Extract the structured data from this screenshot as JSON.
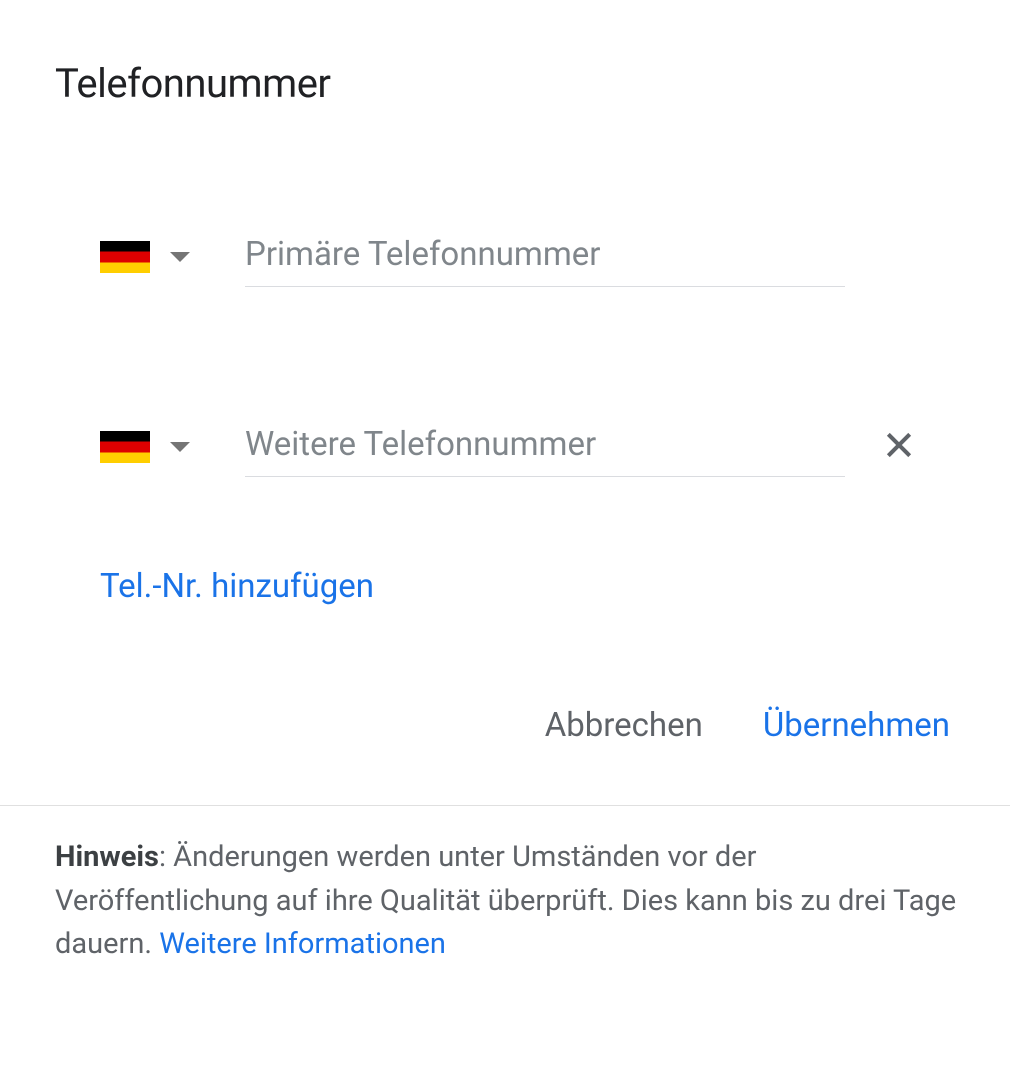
{
  "title": "Telefonnummer",
  "phones": {
    "primary": {
      "placeholder": "Primäre Telefonnummer",
      "value": ""
    },
    "secondary": {
      "placeholder": "Weitere Telefonnummer",
      "value": ""
    }
  },
  "add_link": "Tel.-Nr. hinzufügen",
  "actions": {
    "cancel": "Abbrechen",
    "apply": "Übernehmen"
  },
  "note": {
    "label": "Hinweis",
    "text": ": Änderungen werden unter Umständen vor der Veröffentlichung auf ihre Qualität überprüft. Dies kann bis zu drei Tage dauern. ",
    "link": "Weitere Informationen"
  }
}
